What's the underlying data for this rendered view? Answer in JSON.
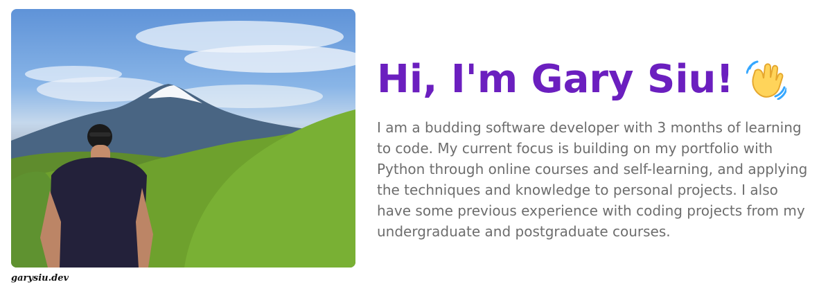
{
  "profile": {
    "heading": "Hi, I'm Gary Siu!",
    "wave_icon": "waving-hand-icon",
    "bio": "I am a budding software developer with 3 months of learning to code. My current focus is building on my portfolio with Python through online courses and self-learning, and applying the techniques and knowledge to personal projects. I also have some previous experience with coding projects from my undergraduate and postgraduate courses.",
    "photo_credit": "garysiu.dev"
  },
  "colors": {
    "heading": "#6b1fbf",
    "body_text": "#6d6d6d",
    "background": "#ffffff"
  }
}
